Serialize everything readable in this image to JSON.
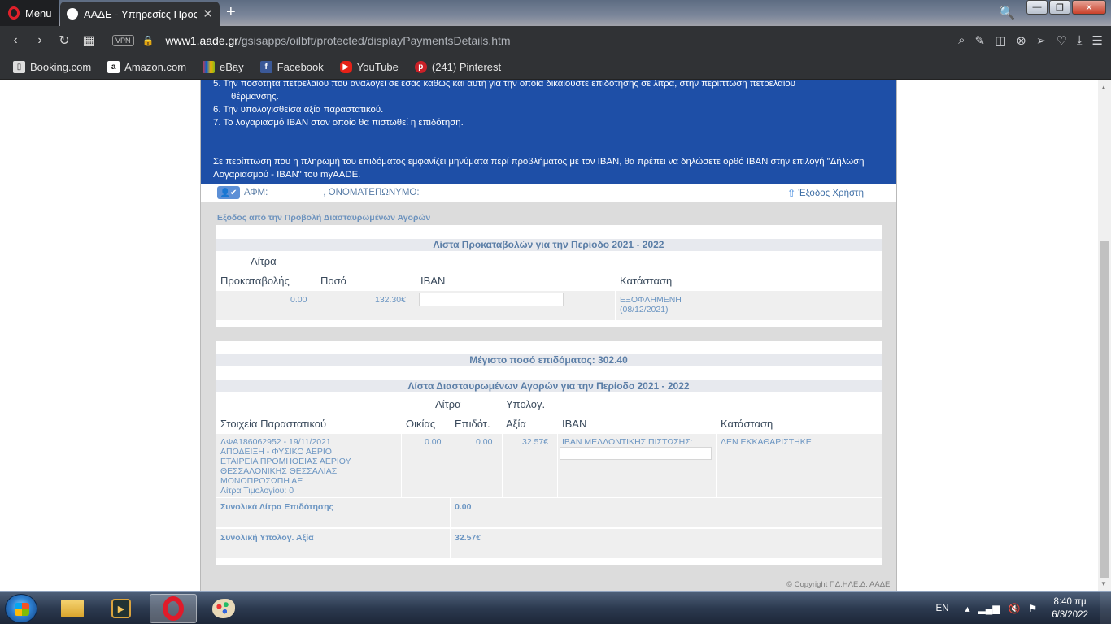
{
  "browser": {
    "menu_label": "Menu",
    "tab_title": "ΑΑΔΕ - Υπηρεσίες Προς Πο",
    "tab_close": "✕",
    "new_tab": "+",
    "url_domain": "www1.aade.gr",
    "url_path": "/gsisapps/oilbft/protected/displayPaymentsDetails.htm",
    "vpn_label": "VPN",
    "bookmarks": [
      {
        "label": "Booking.com",
        "icon": "page-icon"
      },
      {
        "label": "Amazon.com",
        "icon": "amazon-icon"
      },
      {
        "label": "eBay",
        "icon": "ebay-icon"
      },
      {
        "label": "Facebook",
        "icon": "facebook-icon"
      },
      {
        "label": "YouTube",
        "icon": "youtube-icon"
      },
      {
        "label": "(241) Pinterest",
        "icon": "pinterest-icon"
      }
    ]
  },
  "notice": {
    "item5_line1": "5. Την ποσότητα πετρελαίου που αναλογεί σε εσάς καθώς και αυτή για την οποία δικαιούστε επιδότησης σε λίτρα, στην περίπτωση πετρελαίου",
    "item5_line2": "θέρμανσης.",
    "item6": "6. Την υπολογισθείσα αξία παραστατικού.",
    "item7": "7. Το λογαριασμό IBAN στον οποίο θα πιστωθεί η επιδότηση.",
    "hint": "Σε περίπτωση που η πληρωμή του επιδόματος εμφανίζει μηνύματα περί προβλήματος με τον IBAN, θα πρέπει να δηλώσετε ορθό IBAN στην επιλογή \"Δήλωση Λογαριασμού - IBAN\" του myAADE."
  },
  "userbar": {
    "icon_text": "👤✔",
    "afm_label": "ΑΦΜ:",
    "name_label": ", ΟΝΟΜΑΤΕΠΩΝΥΜΟ:",
    "exit_label": "Έξοδος Χρήστη"
  },
  "exit_view_link": "Έξοδος από την Προβολή Διασταυρωμένων Αγορών",
  "advances": {
    "title": "Λίστα Προκαταβολών για την Περίοδο 2021 - 2022",
    "headers": {
      "liters_line1": "Λίτρα",
      "liters_line2": "Προκαταβολής",
      "amount": "Ποσό",
      "iban": "IBAN",
      "status": "Κατάσταση"
    },
    "rows": [
      {
        "liters": "0.00",
        "amount": "132.30€",
        "iban": "",
        "status_line1": "ΕΞΟΦΛΗΜΕΝΗ",
        "status_line2": "(08/12/2021)"
      }
    ]
  },
  "purchases": {
    "max_amount": "Μέγιστο ποσό επιδόματος: 302.40",
    "title": "Λίστα Διασταυρωμένων Αγορών για την Περίοδο 2021 - 2022",
    "headers": {
      "doc": "Στοιχεία Παραστατικού",
      "liters_top": "Λίτρα",
      "home": "Οικίας",
      "subsidy": "Επιδότ.",
      "calc_top": "Υπολογ.",
      "value": "Αξία",
      "iban": "IBAN",
      "status": "Κατάσταση"
    },
    "rows": [
      {
        "doc_lines": [
          "ΛΦΑ186062952 - 19/11/2021",
          "ΑΠΟΔΕΙΞΗ - ΦΥΣΙΚΟ ΑΕΡΙΟ",
          "ΕΤΑΙΡΕΙΑ ΠΡΟΜΗΘΕΙΑΣ ΑΕΡΙΟΥ",
          "ΘΕΣΣΑΛΟΝΙΚΗΣ ΘΕΣΣΑΛΙΑΣ",
          "ΜΟΝΟΠΡΟΣΩΠΗ ΑΕ",
          "Λίτρα Τιμολογίου: 0"
        ],
        "home_liters": "0.00",
        "subsidy_liters": "0.00",
        "value": "32.57€",
        "iban_label": "IBAN ΜΕΛΛΟΝΤΙΚΗΣ ΠΙΣΤΩΣΗΣ:",
        "status": "ΔΕΝ ΕΚΚΑΘΑΡΙΣΤΗΚΕ"
      }
    ],
    "total_liters_label": "Συνολικά Λίτρα Επιδότησης",
    "total_liters": "0.00",
    "total_value_label": "Συνολική Υπολογ. Αξία",
    "total_value": "32.57€"
  },
  "copyright": "© Copyright Γ.Δ.ΗΛΕ.Δ. ΑΑΔΕ",
  "taskbar": {
    "lang": "EN",
    "time": "8:40 πμ",
    "date": "6/3/2022"
  }
}
